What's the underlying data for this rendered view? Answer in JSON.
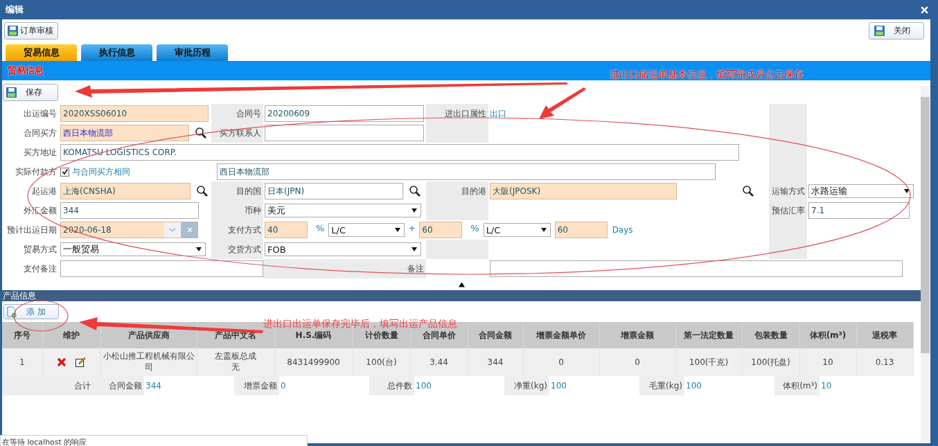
{
  "dialog": {
    "title": "编辑"
  },
  "toolbar": {
    "audit_button": "订单审核",
    "close_button": "关闭"
  },
  "tabs": [
    {
      "label": "贸易信息",
      "selected": true
    },
    {
      "label": "执行信息",
      "selected": false
    },
    {
      "label": "审批历程",
      "selected": false
    }
  ],
  "section_title": "贸易信息",
  "save_button": "保存",
  "form": {
    "shipment_no": {
      "label": "出运编号",
      "value": "2020XSS06010",
      "required": true
    },
    "contract_no": {
      "label": "合同号",
      "value": "20200609",
      "required": false
    },
    "trade_direction": {
      "label": "进出口属性",
      "value": "出口"
    },
    "buyer": {
      "label": "合同买方",
      "value": "西日本物流部",
      "required": true
    },
    "buyer_contact": {
      "label": "买方联系人",
      "required": false
    },
    "buyer_address": {
      "label": "买方地址",
      "value": "KOMATSU LOGISTICS CORP.",
      "required": false
    },
    "payer": {
      "label": "实际付款方",
      "same_as_buyer": {
        "label": "与合同买方相同",
        "checked": true
      },
      "value": "西日本物流部",
      "required": false
    },
    "port_of_loading": {
      "label": "起运港",
      "value": "上海(CNSHA)",
      "required": true
    },
    "destination_country": {
      "label": "目的国",
      "value": "日本(JPN)",
      "required": false
    },
    "port_of_destination": {
      "label": "目的港",
      "value": "大阪(JPOSK)",
      "required": true
    },
    "transport": {
      "label": "运输方式",
      "value": "水路运输"
    },
    "fx_amount": {
      "label": "外汇金额",
      "value": "344",
      "required": false
    },
    "currency": {
      "label": "币种",
      "value": "美元"
    },
    "exchange_rate": {
      "label": "预估汇率",
      "value": "7.1",
      "required": false
    },
    "ship_date": {
      "label": "预计出运日期",
      "value": "2020-06-18",
      "required": true
    },
    "payment": {
      "label": "支付方式",
      "parts": [
        {
          "percent": "40",
          "percent_sign": "%",
          "method": "L/C",
          "required": true
        },
        {
          "percent": "60",
          "percent_sign": "%",
          "method": "L/C",
          "required": true
        }
      ],
      "plus": "+",
      "days": "60",
      "days_required": true,
      "days_unit": "Days"
    },
    "trade_mode": {
      "label": "贸易方式",
      "value": "一般贸易"
    },
    "delivery": {
      "label": "交货方式",
      "value": "FOB"
    },
    "payment_note": {
      "label": "支付备注",
      "required": false
    },
    "remark": {
      "label": "备注",
      "required": false
    }
  },
  "product_section": {
    "title": "产品信息",
    "add_button": "添 加"
  },
  "table": {
    "columns": [
      "序号",
      "维护",
      "产品供应商",
      "产品中文名",
      "H.S.编码",
      "计价数量",
      "合同单价",
      "合同金额",
      "增票金额单价",
      "增票金额",
      "第一法定数量",
      "包装数量",
      "体积(m³)",
      "退税率"
    ],
    "rows": [
      {
        "cells": [
          {
            "kind": "text",
            "text": "1"
          },
          {
            "kind": "actions"
          },
          {
            "kind": "text",
            "text": "小松山推工程机械有限公司"
          },
          {
            "kind": "text",
            "text": "左盖板总成无"
          },
          {
            "kind": "text",
            "text": "8431499900"
          },
          {
            "kind": "text",
            "text": "100(台)"
          },
          {
            "kind": "text",
            "text": "3.44"
          },
          {
            "kind": "text",
            "text": "344"
          },
          {
            "kind": "text",
            "text": "0"
          },
          {
            "kind": "text",
            "text": "0"
          },
          {
            "kind": "text",
            "text": "100(千克)"
          },
          {
            "kind": "text",
            "text": "100(托盘)"
          },
          {
            "kind": "text",
            "text": "10"
          },
          {
            "kind": "text",
            "text": "0.13"
          }
        ]
      }
    ]
  },
  "summary": {
    "label": "合计",
    "items": [
      {
        "label": "合同金额",
        "value": "344"
      },
      {
        "label": "增票金额",
        "value": "0"
      },
      {
        "label": "总件数",
        "value": "100"
      },
      {
        "label": "净重(kg)",
        "value": "100"
      },
      {
        "label": "毛重(kg)",
        "value": "100"
      },
      {
        "label": "体积(m³)",
        "value": "10"
      }
    ]
  },
  "annotations": [
    "进出口储运单基本信息，填写完成后点击保存",
    "进出口出运单保存完毕后，填写出运产品信息"
  ],
  "status_bar": "在等待 localhost 的响应"
}
